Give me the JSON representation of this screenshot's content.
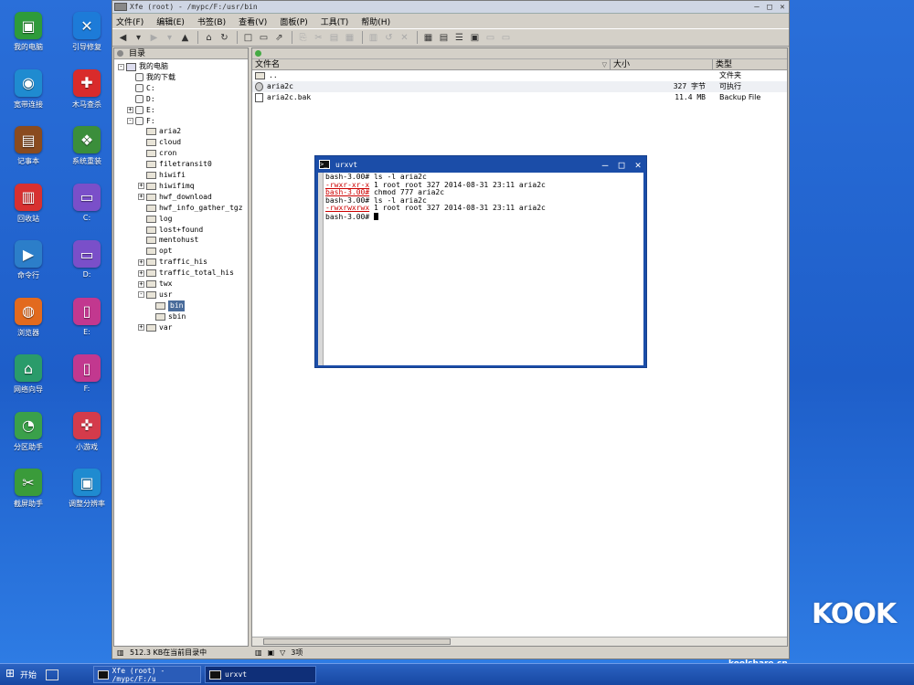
{
  "desktop": {
    "icons": [
      {
        "label": "我的电脑",
        "icon": "computer-icon",
        "color": "#2e9b3a",
        "glyph": "▣"
      },
      {
        "label": "引导修复",
        "icon": "tools-icon",
        "color": "#1d7bd8",
        "glyph": "✕"
      },
      {
        "label": "宽带连接",
        "icon": "network-globe-icon",
        "color": "#1f8bd0",
        "glyph": "◉"
      },
      {
        "label": "木马查杀",
        "icon": "medkit-icon",
        "color": "#d92b2b",
        "glyph": "✚"
      },
      {
        "label": "记事本",
        "icon": "notebook-icon",
        "color": "#8a4b1f",
        "glyph": "▤"
      },
      {
        "label": "系统重装",
        "icon": "windows-logo-icon",
        "color": "#3b8e3b",
        "glyph": "❖"
      },
      {
        "label": "回收站",
        "icon": "trash-icon",
        "color": "#d83030",
        "glyph": "▥"
      },
      {
        "label": "C:",
        "icon": "drive-c-icon",
        "color": "#7a4fc9",
        "glyph": "▭"
      },
      {
        "label": "命令行",
        "icon": "terminal-icon",
        "color": "#2c7ec9",
        "glyph": "▶"
      },
      {
        "label": "D:",
        "icon": "drive-d-icon",
        "color": "#7a4fc9",
        "glyph": "▭"
      },
      {
        "label": "浏览器",
        "icon": "firefox-icon",
        "color": "#e26a1e",
        "glyph": "◍"
      },
      {
        "label": "E:",
        "icon": "usb-drive-e-icon",
        "color": "#c2388f",
        "glyph": "▯"
      },
      {
        "label": "网络向导",
        "icon": "home-network-icon",
        "color": "#2a9b6a",
        "glyph": "⌂"
      },
      {
        "label": "F:",
        "icon": "usb-drive-f-icon",
        "color": "#c2388f",
        "glyph": "▯"
      },
      {
        "label": "分区助手",
        "icon": "pie-chart-icon",
        "color": "#3aa04a",
        "glyph": "◔"
      },
      {
        "label": "小游戏",
        "icon": "gamepad-icon",
        "color": "#d43b4b",
        "glyph": "✜"
      },
      {
        "label": "截屏助手",
        "icon": "scissors-icon",
        "color": "#3a9b3a",
        "glyph": "✂"
      },
      {
        "label": "调整分辨率",
        "icon": "monitor-icon",
        "color": "#1f8bd0",
        "glyph": "▣"
      }
    ]
  },
  "xfe": {
    "title": "Xfe (root) - /mypc/F:/usr/bin",
    "menu": [
      "文件(F)",
      "编辑(E)",
      "书签(B)",
      "查看(V)",
      "面板(P)",
      "工具(T)",
      "帮助(H)"
    ],
    "toolbar_icons": [
      {
        "icon": "back-arrow-icon",
        "glyph": "◀"
      },
      {
        "icon": "history-dropdown-icon",
        "glyph": "▾"
      },
      {
        "icon": "forward-arrow-icon",
        "glyph": "▶",
        "dim": true
      },
      {
        "icon": "forward-dropdown-icon",
        "glyph": "▾",
        "dim": true
      },
      {
        "icon": "up-arrow-icon",
        "glyph": "▲"
      },
      {
        "icon": "home-icon",
        "glyph": "⌂"
      },
      {
        "icon": "refresh-icon",
        "glyph": "↻"
      },
      {
        "icon": "new-file-icon",
        "glyph": "□"
      },
      {
        "icon": "new-folder-icon",
        "glyph": "▭"
      },
      {
        "icon": "new-link-icon",
        "glyph": "⇗"
      },
      {
        "icon": "copy-icon",
        "glyph": "⎘",
        "dim": true
      },
      {
        "icon": "cut-icon",
        "glyph": "✂",
        "dim": true
      },
      {
        "icon": "paste-icon",
        "glyph": "▤",
        "dim": true
      },
      {
        "icon": "properties-icon",
        "glyph": "▦",
        "dim": true
      },
      {
        "icon": "trash-icon",
        "glyph": "▥",
        "dim": true
      },
      {
        "icon": "restore-icon",
        "glyph": "↺",
        "dim": true
      },
      {
        "icon": "delete-icon",
        "glyph": "✕",
        "dim": true
      },
      {
        "icon": "big-icons-icon",
        "glyph": "▦"
      },
      {
        "icon": "small-icons-icon",
        "glyph": "▤"
      },
      {
        "icon": "detailed-list-icon",
        "glyph": "☰"
      },
      {
        "icon": "terminal-icon",
        "glyph": "▣"
      },
      {
        "icon": "one-panel-icon",
        "glyph": "▭",
        "dim": true
      },
      {
        "icon": "two-panel-icon",
        "glyph": "▭",
        "dim": true
      }
    ],
    "tree": {
      "header": "目录",
      "status": "512.3 KB在当前目录中",
      "rows": [
        {
          "label": "我的电脑",
          "kind": "computer",
          "depth": 0,
          "exp": "-"
        },
        {
          "label": "我的下载",
          "kind": "drive",
          "depth": 1,
          "exp": ""
        },
        {
          "label": "C:",
          "kind": "drive",
          "depth": 1,
          "exp": ""
        },
        {
          "label": "D:",
          "kind": "drive",
          "depth": 1,
          "exp": ""
        },
        {
          "label": "E:",
          "kind": "drive",
          "depth": 1,
          "exp": "+"
        },
        {
          "label": "F:",
          "kind": "drive",
          "depth": 1,
          "exp": "-"
        },
        {
          "label": "aria2",
          "kind": "folder",
          "depth": 2,
          "exp": ""
        },
        {
          "label": "cloud",
          "kind": "folder",
          "depth": 2,
          "exp": ""
        },
        {
          "label": "cron",
          "kind": "folder",
          "depth": 2,
          "exp": ""
        },
        {
          "label": "filetransit0",
          "kind": "folder",
          "depth": 2,
          "exp": ""
        },
        {
          "label": "hiwifi",
          "kind": "folder",
          "depth": 2,
          "exp": ""
        },
        {
          "label": "hiwifimq",
          "kind": "folder",
          "depth": 2,
          "exp": "+"
        },
        {
          "label": "hwf_download",
          "kind": "folder",
          "depth": 2,
          "exp": "+"
        },
        {
          "label": "hwf_info_gather_tgz",
          "kind": "folder",
          "depth": 2,
          "exp": ""
        },
        {
          "label": "log",
          "kind": "folder",
          "depth": 2,
          "exp": ""
        },
        {
          "label": "lost+found",
          "kind": "folder",
          "depth": 2,
          "exp": ""
        },
        {
          "label": "mentohust",
          "kind": "folder",
          "depth": 2,
          "exp": ""
        },
        {
          "label": "opt",
          "kind": "folder",
          "depth": 2,
          "exp": ""
        },
        {
          "label": "traffic_his",
          "kind": "folder",
          "depth": 2,
          "exp": "+"
        },
        {
          "label": "traffic_total_his",
          "kind": "folder",
          "depth": 2,
          "exp": "+"
        },
        {
          "label": "twx",
          "kind": "folder",
          "depth": 2,
          "exp": "+"
        },
        {
          "label": "usr",
          "kind": "folder",
          "depth": 2,
          "exp": "-"
        },
        {
          "label": "bin",
          "kind": "folder",
          "depth": 3,
          "exp": "",
          "selected": true
        },
        {
          "label": "sbin",
          "kind": "folder",
          "depth": 3,
          "exp": ""
        },
        {
          "label": "var",
          "kind": "folder",
          "depth": 2,
          "exp": "+"
        }
      ]
    },
    "list": {
      "columns": [
        "文件名",
        "大小",
        "类型"
      ],
      "rows": [
        {
          "name": "..",
          "size": "",
          "type": "文件夹",
          "icon": "up"
        },
        {
          "name": "aria2c",
          "size": "327 字节",
          "type": "可执行",
          "icon": "exe"
        },
        {
          "name": "aria2c.bak",
          "size": "11.4 MB",
          "type": "Backup File",
          "icon": "file"
        }
      ],
      "status": "3项"
    }
  },
  "terminal": {
    "title": "urxvt",
    "lines": [
      {
        "prompt": "bash-3.00#",
        "text": " ls -l aria2c"
      },
      {
        "mark": "-rwxr-xr-x",
        "text": " 1 root root 327 2014-08-31 23:11 aria2c"
      },
      {
        "prompt_sel": "bash-3.00#",
        "text": " chmod 777 aria2c"
      },
      {
        "prompt": "bash-3.00#",
        "text": " ls -l aria2c"
      },
      {
        "mark": "-rwxrwxrwx",
        "text": " 1 root root 327 2014-08-31 23:11 aria2c"
      },
      {
        "prompt": "bash-3.00#",
        "text": " ",
        "cursor": true
      }
    ]
  },
  "taskbar": {
    "start": "开始",
    "tasks": [
      {
        "label": "Xfe (root) - /mypc/F:/u",
        "active": false
      },
      {
        "label": "urxvt",
        "active": true
      }
    ]
  },
  "watermark": {
    "logo": "KOOK",
    "url": "koolshare.cn"
  }
}
